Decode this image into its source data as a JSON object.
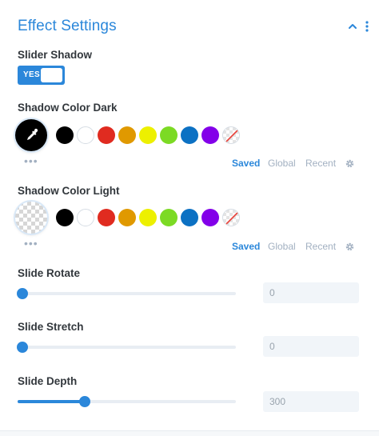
{
  "header": {
    "title": "Effect Settings",
    "collapse_icon": "chevron-up-icon",
    "more_icon": "vertical-dots-icon"
  },
  "slider_shadow": {
    "label": "Slider Shadow",
    "toggle_text": "YES",
    "value": true
  },
  "shadow_dark": {
    "label": "Shadow Color Dark",
    "picker_icon": "eyedropper-icon",
    "tabs": [
      "Saved",
      "Global",
      "Recent"
    ],
    "active_tab": "Saved",
    "dots": "•••"
  },
  "shadow_light": {
    "label": "Shadow Color Light",
    "tabs": [
      "Saved",
      "Global",
      "Recent"
    ],
    "active_tab": "Saved",
    "dots": "•••"
  },
  "swatches": [
    "#000000",
    "#ffffff",
    "#e02b20",
    "#e09900",
    "#edf000",
    "#7cda24",
    "#0c71c3",
    "#8300e9",
    "none"
  ],
  "sliders": [
    {
      "label": "Slide Rotate",
      "value": "0",
      "fraction": 0.0
    },
    {
      "label": "Slide Stretch",
      "value": "0",
      "fraction": 0.0
    },
    {
      "label": "Slide Depth",
      "value": "300",
      "fraction": 0.3
    }
  ],
  "colors": {
    "accent": "#2b87da",
    "muted": "#a2b0c1",
    "text": "#32373c"
  }
}
